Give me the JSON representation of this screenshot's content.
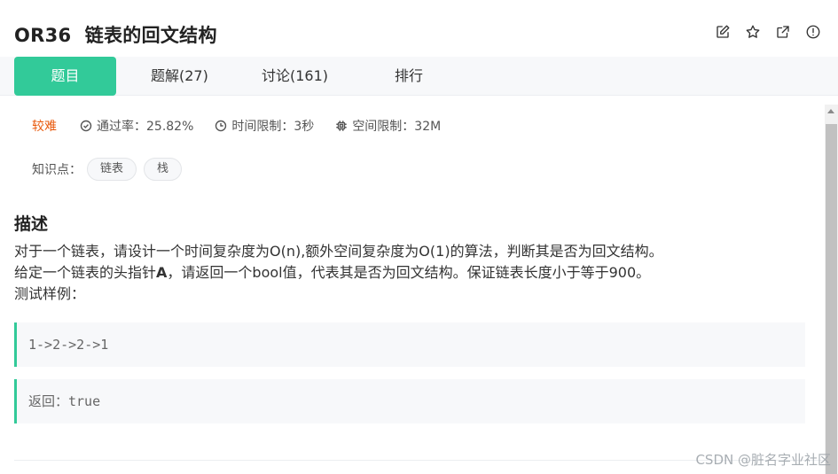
{
  "problem": {
    "code": "OR36",
    "title": "链表的回文结构"
  },
  "toolbar": {
    "icons": [
      "edit-icon",
      "star-icon",
      "external-link-icon",
      "alert-icon"
    ]
  },
  "tabs": [
    {
      "label": "题目",
      "active": true
    },
    {
      "label": "题解(27)",
      "active": false
    },
    {
      "label": "讨论(161)",
      "active": false
    },
    {
      "label": "排行",
      "active": false
    }
  ],
  "info": {
    "difficulty": "较难",
    "pass_rate": "通过率：25.82%",
    "time_limit": "时间限制：3秒",
    "space_limit": "空间限制：32M"
  },
  "knowledge": {
    "label": "知识点：",
    "tags": [
      "链表",
      "栈"
    ]
  },
  "description": {
    "heading": "描述",
    "line1": "对于一个链表，请设计一个时间复杂度为O(n),额外空间复杂度为O(1)的算法，判断其是否为回文结构。",
    "line2_pre": "给定一个链表的头指针",
    "line2_bold": "A",
    "line2_post": "，请返回一个bool值，代表其是否为回文结构。保证链表长度小于等于900。",
    "line3": "测试样例："
  },
  "samples": {
    "input": "1->2->2->1",
    "output": "返回：true"
  },
  "watermark": "CSDN @脏名字业社区",
  "colors": {
    "accent": "#32ca99",
    "difficulty": "#e8590c"
  }
}
